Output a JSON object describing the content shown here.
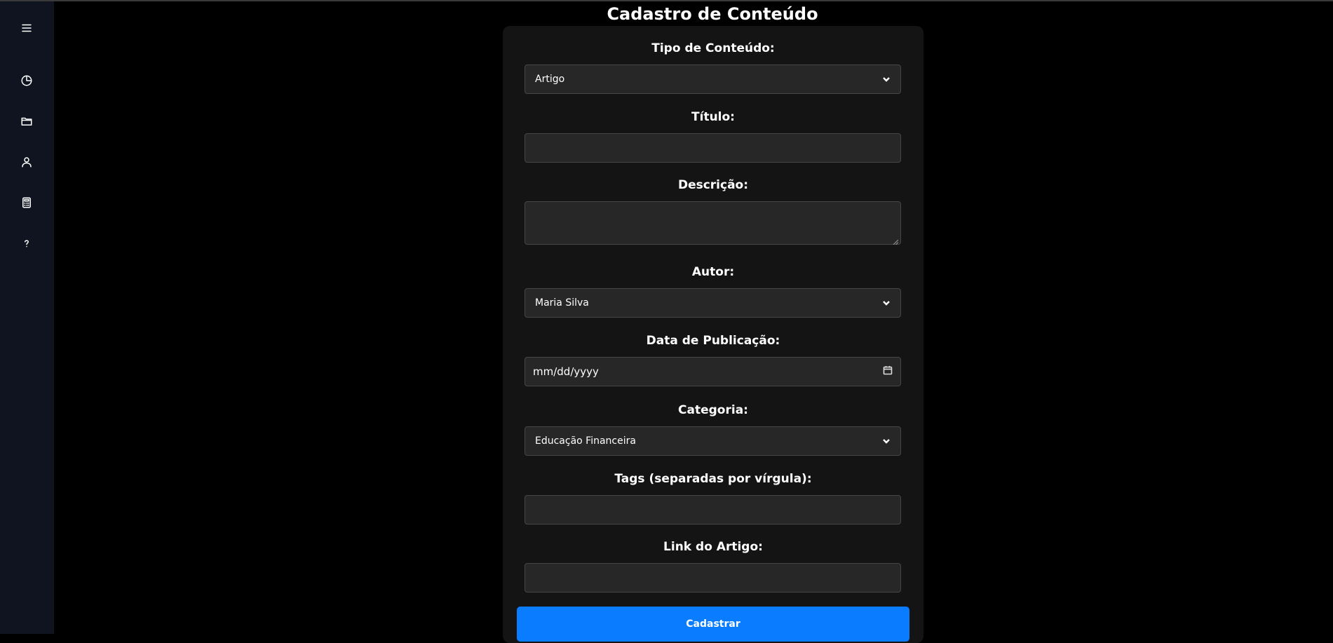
{
  "page": {
    "title": "Cadastro de Conteúdo"
  },
  "sidebar": {
    "icons": [
      "menu-icon",
      "pie-chart-icon",
      "folder-icon",
      "user-icon",
      "calculator-icon",
      "help-icon"
    ]
  },
  "form": {
    "tipo": {
      "label": "Tipo de Conteúdo:",
      "value": "Artigo"
    },
    "titulo": {
      "label": "Título:",
      "value": ""
    },
    "descricao": {
      "label": "Descrição:",
      "value": ""
    },
    "autor": {
      "label": "Autor:",
      "value": "Maria Silva"
    },
    "data": {
      "label": "Data de Publicação:",
      "placeholder": "mm/dd/yyyy"
    },
    "categoria": {
      "label": "Categoria:",
      "value": "Educação Financeira"
    },
    "tags": {
      "label": "Tags (separadas por vírgula):",
      "value": ""
    },
    "link": {
      "label": "Link do Artigo:",
      "value": ""
    },
    "submit_label": "Cadastrar"
  },
  "colors": {
    "background": "#000000",
    "sidebar": "#0f1420",
    "card": "#141414",
    "input": "#272727",
    "accent": "#0a7cff"
  }
}
